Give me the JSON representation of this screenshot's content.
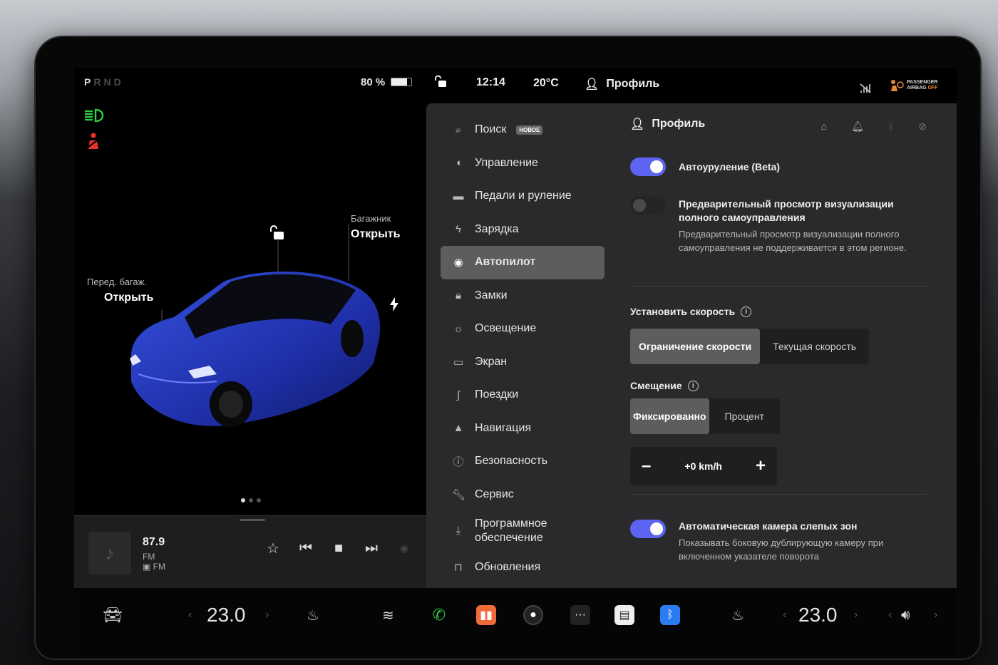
{
  "gear": {
    "p": "P",
    "rest": "RND"
  },
  "battery": {
    "percent_label": "80 %",
    "level": 0.8
  },
  "car": {
    "trunk_label": "Багажник",
    "trunk_action": "Открыть",
    "frunk_label": "Перед. багаж.",
    "frunk_action": "Открыть"
  },
  "media": {
    "frequency": "87.9",
    "band": "FM",
    "source": "FM"
  },
  "status": {
    "time": "12:14",
    "temperature": "20°C",
    "profile": "Профиль",
    "airbag_line1": "PASSENGER",
    "airbag_line2": "AIRBAG",
    "airbag_state": "OFF"
  },
  "menu": {
    "items": [
      {
        "label": "Поиск",
        "icon": "search-icon",
        "badge": "НОВОЕ"
      },
      {
        "label": "Управление",
        "icon": "toggle-icon"
      },
      {
        "label": "Педали и руление",
        "icon": "car-icon"
      },
      {
        "label": "Зарядка",
        "icon": "bolt-icon"
      },
      {
        "label": "Автопилот",
        "icon": "steering-wheel-icon",
        "active": true
      },
      {
        "label": "Замки",
        "icon": "lock-icon"
      },
      {
        "label": "Освещение",
        "icon": "sun-icon"
      },
      {
        "label": "Экран",
        "icon": "display-icon"
      },
      {
        "label": "Поездки",
        "icon": "trips-icon"
      },
      {
        "label": "Навигация",
        "icon": "navigation-icon"
      },
      {
        "label": "Безопасность",
        "icon": "alert-icon"
      },
      {
        "label": "Сервис",
        "icon": "wrench-icon"
      },
      {
        "label": "Программное обеспечение",
        "icon": "download-icon"
      },
      {
        "label": "Обновления",
        "icon": "bag-icon"
      }
    ]
  },
  "content": {
    "header": "Профиль",
    "autosteer": {
      "label": "Автоуруление (Beta)",
      "on": true
    },
    "fsd_preview": {
      "title": "Предварительный просмотр визуализации полного самоуправления",
      "description": "Предварительный просмотр визуализации полного самоуправления не поддерживается в этом регионе.",
      "on": false
    },
    "set_speed": {
      "label": "Установить скорость",
      "options": [
        "Ограничение скорости",
        "Текущая скорость"
      ],
      "selected": 0
    },
    "offset": {
      "label": "Смещение",
      "options": [
        "Фиксированно",
        "Процент"
      ],
      "selected": 0,
      "value": "+0 km/h",
      "minus": "–",
      "plus": "+"
    },
    "blindspot": {
      "title": "Автоматическая камера слепых зон",
      "description": "Показывать боковую дублирующую камеру при включенном указателе поворота",
      "on": true
    }
  },
  "dock": {
    "left_temp": "23.0",
    "right_temp": "23.0"
  },
  "colors": {
    "accent": "#5e64f2",
    "panel": "#2a2a2c",
    "active_menu": "#5d5d60",
    "lights_green": "#2ecc40",
    "seatbelt_red": "#e8322f",
    "airbag_off": "#e48a3a"
  }
}
